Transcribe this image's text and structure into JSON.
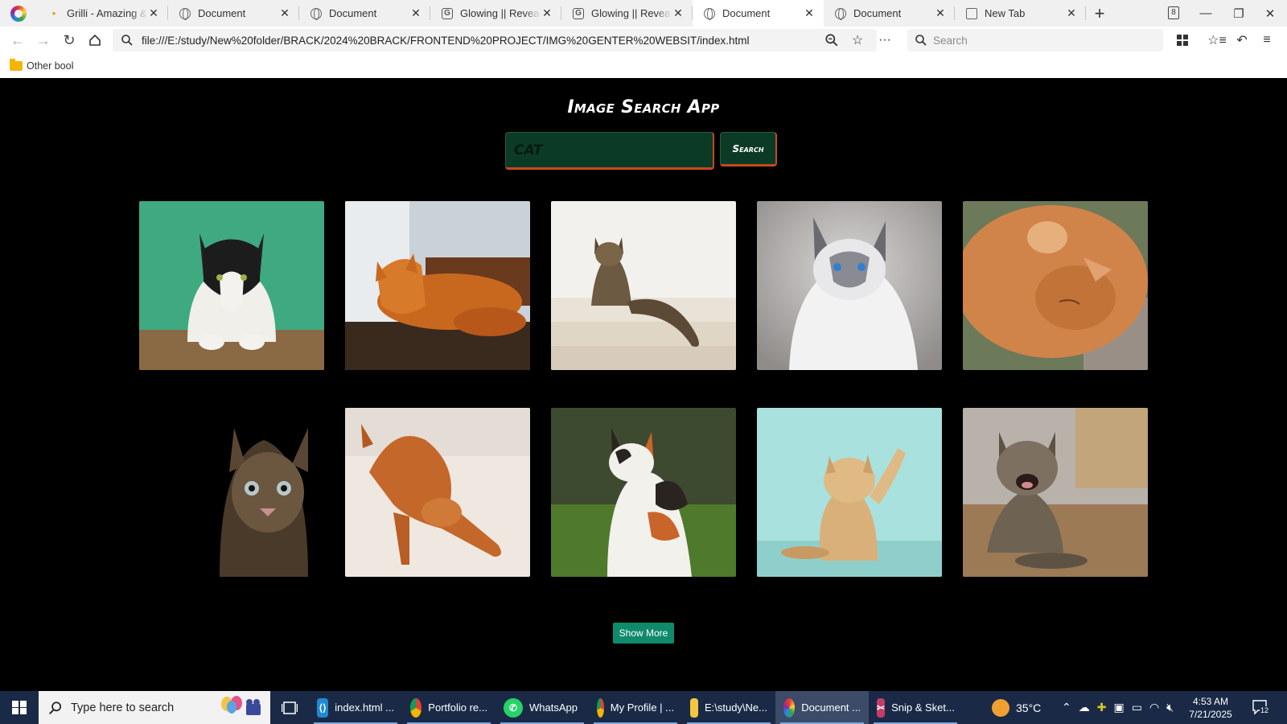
{
  "browser": {
    "tabs": [
      {
        "label": "Grilli - Amazing & Delicious",
        "icon": "dot"
      },
      {
        "label": "Document",
        "icon": "globe"
      },
      {
        "label": "Document",
        "icon": "globe"
      },
      {
        "label": "Glowing || Reveal Text",
        "icon": "g"
      },
      {
        "label": "Glowing || Reveal Text",
        "icon": "g"
      },
      {
        "label": "Document",
        "icon": "globe",
        "active": true
      },
      {
        "label": "Document",
        "icon": "globe"
      },
      {
        "label": "New Tab",
        "icon": "newtab"
      }
    ],
    "tab_count": "8",
    "url": "file:///E:/study/New%20folder/BRACK/2024%20BRACK/FRONTEND%20PROJECT/IMG%20GENTER%20WEBSIT/index.html",
    "search_placeholder": "Search",
    "bookmark_folder": "Other bookmarks"
  },
  "app": {
    "title": "Image Search App",
    "search_value": "",
    "search_placeholder": "CAT",
    "search_button": "Search",
    "show_more": "Show More",
    "images": [
      {
        "subject": "tuxedo cat on green background"
      },
      {
        "subject": "orange long-haired cat lying on table"
      },
      {
        "subject": "tabby cat sitting on white stairs"
      },
      {
        "subject": "white siamese cat with blue eyes"
      },
      {
        "subject": "orange cat sleeping with paw"
      },
      {
        "subject": "tabby cat face on black background"
      },
      {
        "subject": "orange abyssinian cat stretching"
      },
      {
        "subject": "calico cat on grass"
      },
      {
        "subject": "kitten raising paw on teal background"
      },
      {
        "subject": "tabby kitten meowing on wood floor"
      }
    ]
  },
  "taskbar": {
    "search_placeholder": "Type here to search",
    "apps": [
      {
        "label": "index.html ...",
        "icon": "vscode-icon"
      },
      {
        "label": "Portfolio re...",
        "icon": "chrome-icon"
      },
      {
        "label": "WhatsApp",
        "icon": "whatsapp-icon"
      },
      {
        "label": "My Profile | ...",
        "icon": "chrome-icon"
      },
      {
        "label": "E:\\study\\Ne...",
        "icon": "folder-icon"
      },
      {
        "label": "Document ...",
        "icon": "browser-icon",
        "active": true
      },
      {
        "label": "Snip & Sket...",
        "icon": "snip-icon"
      }
    ],
    "weather": "35°C",
    "time": "4:53 AM",
    "date": "7/21/2025",
    "notification_count": "12"
  }
}
